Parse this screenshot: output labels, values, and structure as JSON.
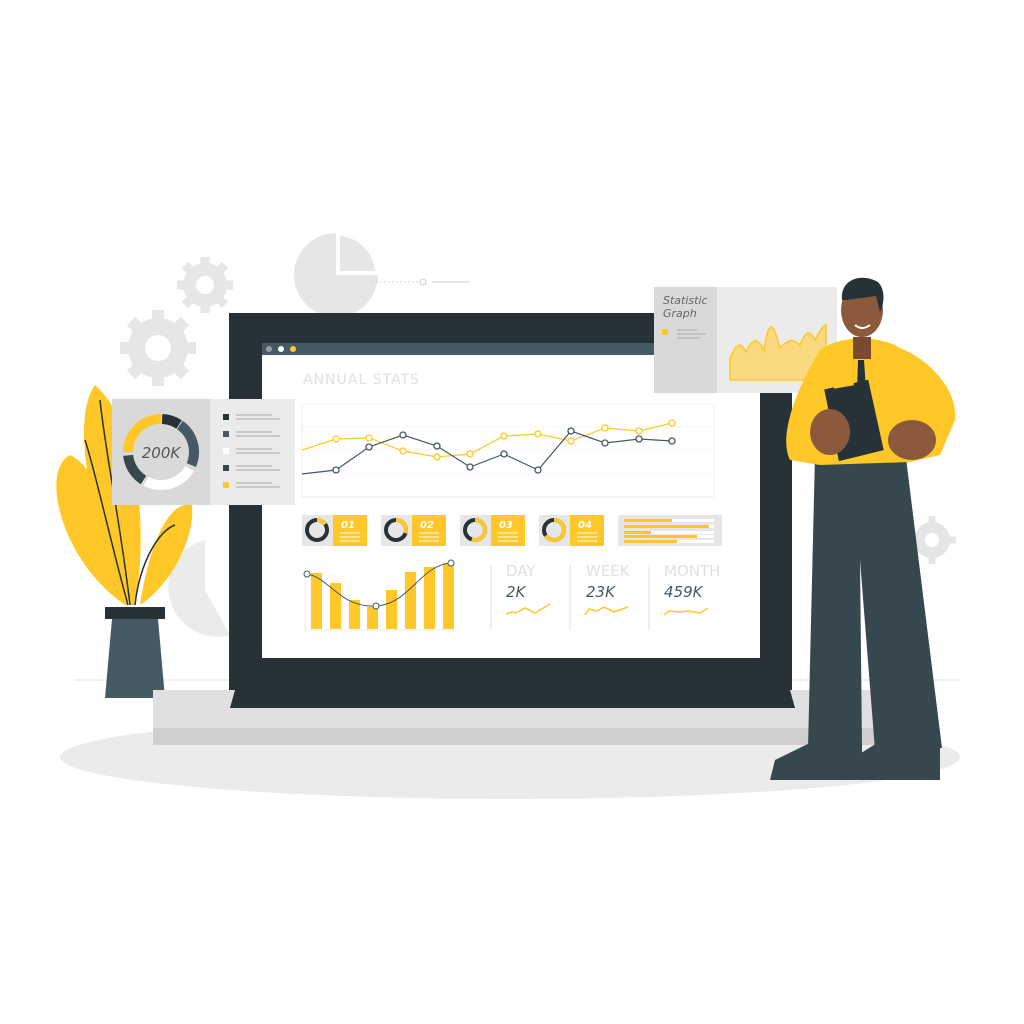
{
  "colors": {
    "accent": "#ffc727",
    "dark": "#263238",
    "slate": "#455a64",
    "light_gray": "#e6e6e6",
    "skin": "#8b5a3c"
  },
  "screen": {
    "window_dots": [
      "#9e9e9e",
      "#ffffff",
      "#ffc727"
    ],
    "title": "ANNUAL STATS",
    "kpi_cards": [
      {
        "label": "01"
      },
      {
        "label": "02"
      },
      {
        "label": "03"
      },
      {
        "label": "04"
      }
    ],
    "stats": [
      {
        "label": "DAY",
        "value": "2K"
      },
      {
        "label": "WEEK",
        "value": "23K"
      },
      {
        "label": "MONTH",
        "value": "459K"
      }
    ]
  },
  "donut_card": {
    "center_text": "200K",
    "legend_colors": [
      "#263238",
      "#455a64",
      "#ffffff",
      "#37474f",
      "#ffc727"
    ]
  },
  "graph_card": {
    "title_line1": "Statistic",
    "title_line2": "Graph"
  }
}
